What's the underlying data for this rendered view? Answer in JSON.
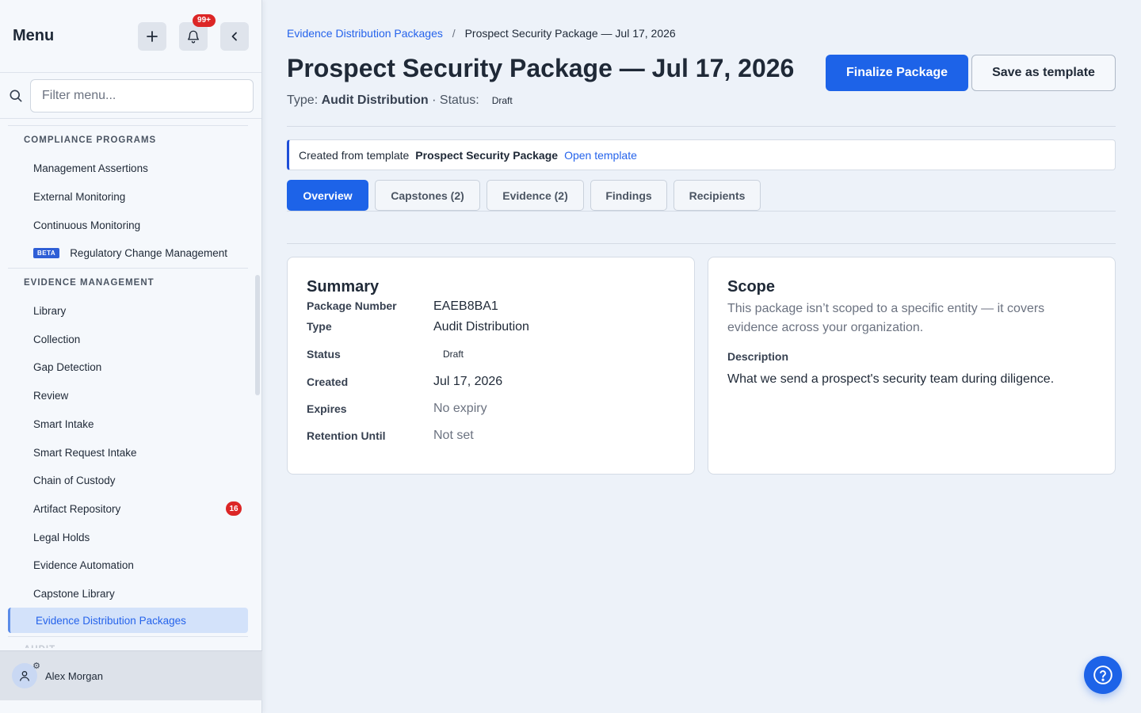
{
  "sidebar": {
    "title": "Menu",
    "notifications_badge": "99+",
    "filter_placeholder": "Filter menu...",
    "sections": [
      {
        "title": "COMPLIANCE PROGRAMS",
        "items": [
          {
            "label": "Management Assertions"
          },
          {
            "label": "External Monitoring"
          },
          {
            "label": "Continuous Monitoring"
          },
          {
            "label": "Regulatory Change Management",
            "tag": "BETA"
          }
        ]
      },
      {
        "title": "EVIDENCE MANAGEMENT",
        "items": [
          {
            "label": "Library"
          },
          {
            "label": "Collection"
          },
          {
            "label": "Gap Detection"
          },
          {
            "label": "Review"
          },
          {
            "label": "Smart Intake"
          },
          {
            "label": "Smart Request Intake"
          },
          {
            "label": "Chain of Custody"
          },
          {
            "label": "Artifact Repository",
            "badge": "16"
          },
          {
            "label": "Legal Holds"
          },
          {
            "label": "Evidence Automation"
          },
          {
            "label": "Capstone Library"
          },
          {
            "label": "Evidence Distribution Packages",
            "active": true
          }
        ]
      }
    ],
    "next_section_partial": "AUDIT",
    "user": {
      "name": "Alex Morgan"
    }
  },
  "breadcrumb": {
    "parent": "Evidence Distribution Packages",
    "separator": "/",
    "current": "Prospect Security Package — Jul 17, 2026"
  },
  "header": {
    "title": "Prospect Security Package — Jul 17, 2026",
    "type_label": "Type:",
    "type_value": "Audit Distribution",
    "status_label": "· Status:",
    "status_value": "Draft",
    "primary_button": "Finalize Package",
    "secondary_button": "Save as template"
  },
  "template_notice": {
    "prefix": "Created from template",
    "template_name": "Prospect Security Package",
    "link": "Open template"
  },
  "tabs": [
    {
      "label": "Overview",
      "active": true
    },
    {
      "label": "Capstones (2)"
    },
    {
      "label": "Evidence (2)"
    },
    {
      "label": "Findings"
    },
    {
      "label": "Recipients"
    }
  ],
  "summary": {
    "title": "Summary",
    "rows": [
      {
        "key": "Package Number",
        "value": "EAEB8BA1"
      },
      {
        "key": "Type",
        "value": "Audit Distribution"
      },
      {
        "key": "Status",
        "value": "Draft"
      },
      {
        "key": "Created",
        "value": "Jul 17, 2026"
      },
      {
        "key": "Expires",
        "value": "No expiry"
      },
      {
        "key": "Retention Until",
        "value": "Not set"
      }
    ]
  },
  "scope": {
    "title": "Scope",
    "text": "This package isn’t scoped to a specific entity — it covers evidence across your organization.",
    "description_label": "Description",
    "description": "What we send a prospect's security team during diligence."
  },
  "colors": {
    "accent": "#1d63e8",
    "badge": "#dc2626",
    "active_nav_bg": "#d3e2fa"
  }
}
